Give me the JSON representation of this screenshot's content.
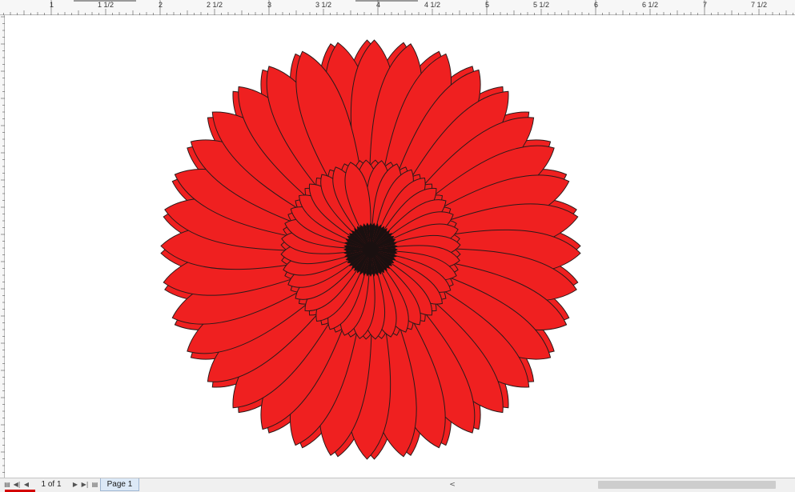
{
  "ruler": {
    "ticks": [
      "1",
      "1 1/2",
      "2",
      "2 1/2",
      "3",
      "3 1/2",
      "4",
      "4 1/2",
      "5",
      "5 1/2",
      "6",
      "6 1/2",
      "7",
      "7 1/2"
    ]
  },
  "document": {
    "page_count": "1 of 1",
    "page_tab": "Page 1"
  },
  "artwork": {
    "fill_color": "#ef2020",
    "outline_color": "#2a1a1a",
    "center_color": "#1a1010",
    "background": "#ffffff"
  },
  "icons": {
    "first_page": "first-page-icon",
    "prev_page": "prev-page-icon",
    "next_page": "next-page-icon",
    "last_page": "last-page-icon",
    "add_page": "add-page-icon",
    "scroll_left": "scroll-left-icon"
  }
}
